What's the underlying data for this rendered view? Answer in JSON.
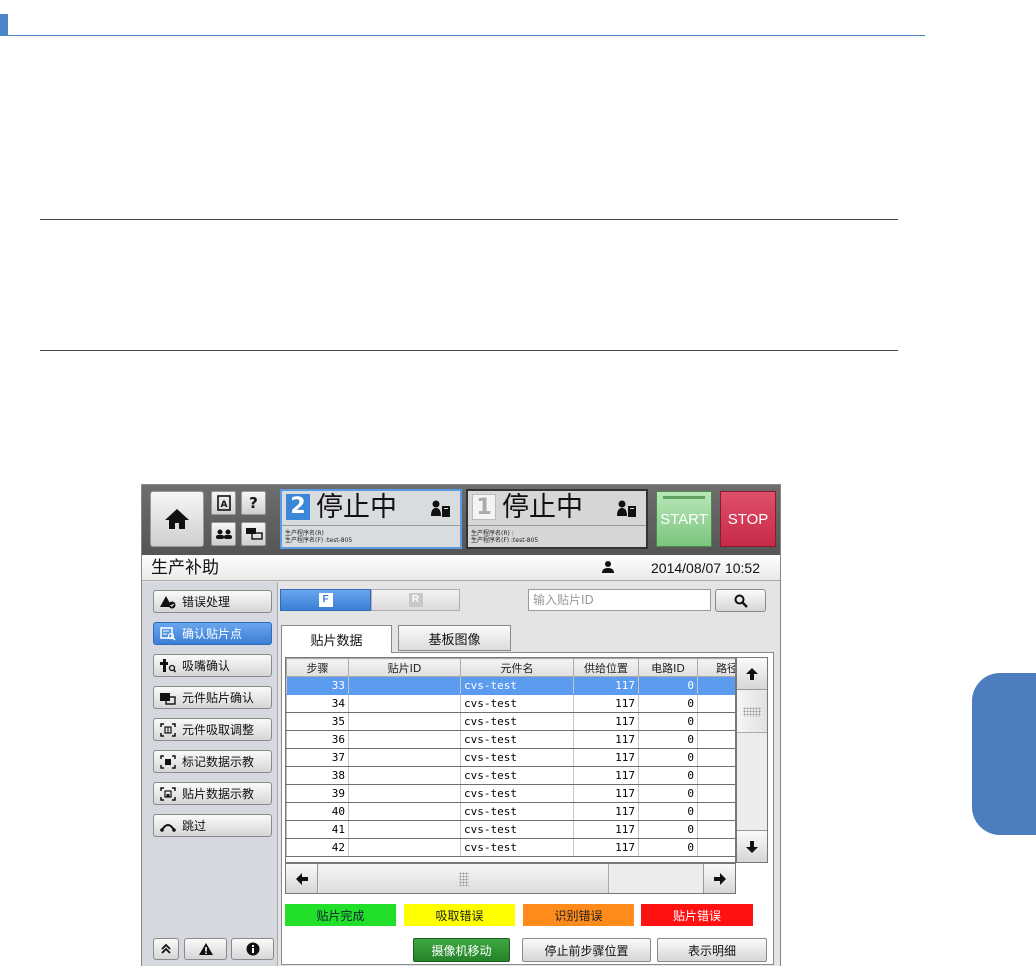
{
  "colors": {
    "doc_accent": "#4a86c8",
    "side_tab": "#4c7dbe",
    "active_blue": "#3a7ed6",
    "selected_row": "#5b9bf0",
    "start_green": "#7cc57e",
    "stop_red": "#c62a48",
    "legend_green": "#22e02a",
    "legend_yellow": "#ffff00",
    "legend_orange": "#ff8c1a",
    "legend_red": "#ff1111",
    "camera_button": "#25822a"
  },
  "header": {
    "home_icon": "home-icon",
    "keyboard_icon": "keyboard-a-icon",
    "help_label": "?",
    "users_icon": "users-icon",
    "network_icon": "network-icon",
    "lanes": [
      {
        "number": "2",
        "status": "停止中",
        "icon": "operator-clipboard-icon",
        "prog_r": "生产程序名(R)",
        "prog_f": "生产程序名(F) :test-805"
      },
      {
        "number": "1",
        "status": "停止中",
        "icon": "operator-clipboard-icon",
        "prog_r": "生产程序名(R) :",
        "prog_f": "生产程序名(F) :test-805"
      }
    ],
    "start_label": "START",
    "stop_label": "STOP"
  },
  "titlebar": {
    "title": "生产补助",
    "user_icon": "user-icon",
    "datetime": "2014/08/07 10:52"
  },
  "menu": {
    "items": [
      {
        "label": "错误处理",
        "icon": "error-handling-icon",
        "active": false
      },
      {
        "label": "确认贴片点",
        "icon": "confirm-mount-point-icon",
        "active": true
      },
      {
        "label": "吸嘴确认",
        "icon": "nozzle-icon",
        "active": false
      },
      {
        "label": "元件贴片确认",
        "icon": "component-mount-icon",
        "active": false
      },
      {
        "label": "元件吸取调整",
        "icon": "pickup-adjust-icon",
        "active": false
      },
      {
        "label": "标记数据示教",
        "icon": "mark-teach-icon",
        "active": false
      },
      {
        "label": "贴片数据示教",
        "icon": "mount-teach-icon",
        "active": false
      },
      {
        "label": "跳过",
        "icon": "skip-icon",
        "active": false
      }
    ],
    "footer": {
      "collapse_icon": "double-chevron-up-icon",
      "warning_icon": "warning-icon",
      "info_icon": "info-icon"
    }
  },
  "main": {
    "segment_f": "F",
    "segment_r": "R",
    "search": {
      "placeholder": "输入贴片ID",
      "value": "",
      "icon": "search-icon"
    },
    "tabs": [
      {
        "label": "贴片数据",
        "active": true
      },
      {
        "label": "基板图像",
        "active": false
      }
    ],
    "table": {
      "columns": [
        "步骤",
        "贴片ID",
        "元件名",
        "供给位置",
        "电路ID",
        "路径"
      ],
      "selected_index": 0,
      "rows": [
        [
          "33",
          "",
          "cvs-test",
          "117",
          "0",
          ""
        ],
        [
          "34",
          "",
          "cvs-test",
          "117",
          "0",
          ""
        ],
        [
          "35",
          "",
          "cvs-test",
          "117",
          "0",
          ""
        ],
        [
          "36",
          "",
          "cvs-test",
          "117",
          "0",
          ""
        ],
        [
          "37",
          "",
          "cvs-test",
          "117",
          "0",
          ""
        ],
        [
          "38",
          "",
          "cvs-test",
          "117",
          "0",
          ""
        ],
        [
          "39",
          "",
          "cvs-test",
          "117",
          "0",
          ""
        ],
        [
          "40",
          "",
          "cvs-test",
          "117",
          "0",
          ""
        ],
        [
          "41",
          "",
          "cvs-test",
          "117",
          "0",
          ""
        ],
        [
          "42",
          "",
          "cvs-test",
          "117",
          "0",
          ""
        ]
      ]
    },
    "legend": {
      "mount_done": "贴片完成",
      "pickup_error": "吸取错误",
      "recognition_error": "识别错误",
      "mount_error": "贴片错误"
    },
    "actions": {
      "camera_move": "摄像机移动",
      "stop_prev_step": "停止前步骤位置",
      "show_detail": "表示明细"
    }
  }
}
